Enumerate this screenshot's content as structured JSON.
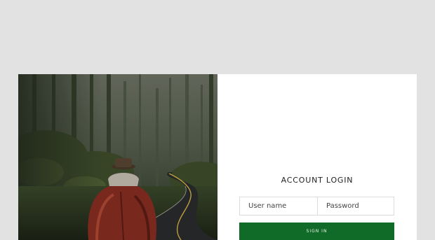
{
  "login": {
    "title": "ACCOUNT LOGIN",
    "username_placeholder": "User name",
    "password_placeholder": "Password",
    "signin_label": "SIGN IN"
  },
  "colors": {
    "page_background": "#e2e2e2",
    "card_background": "#ffffff",
    "button_background": "#0f6b27",
    "field_border": "#dcdcdc"
  },
  "hero_image": {
    "subject": "person in red jacket and hat walking on a winding forest road"
  }
}
